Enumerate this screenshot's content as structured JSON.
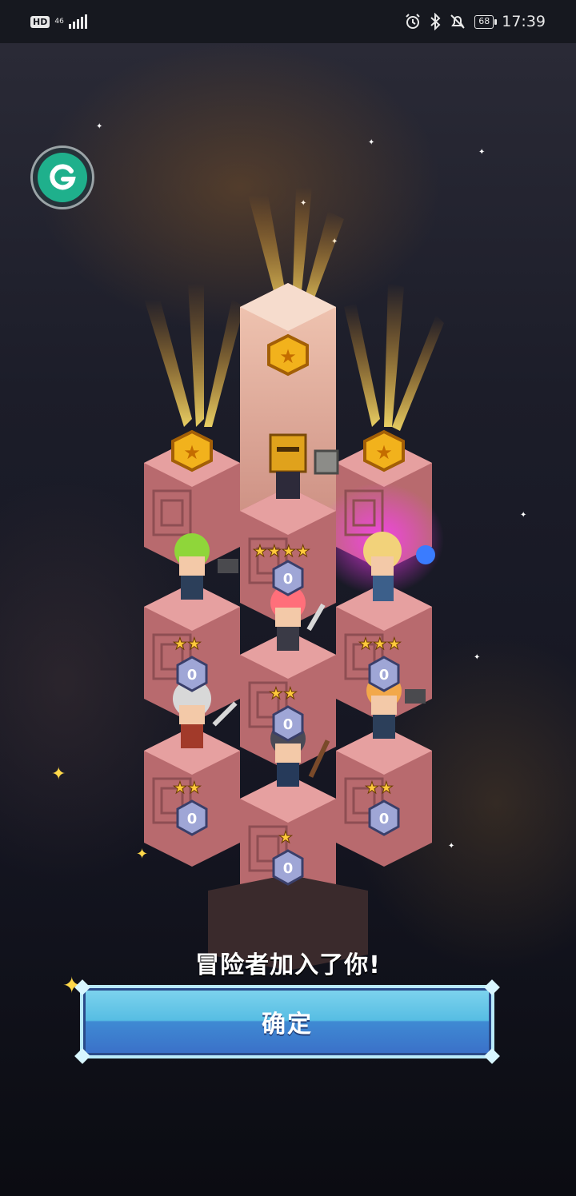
{
  "status_bar": {
    "hd": "HD",
    "network": "46",
    "battery": "68",
    "time": "17:39"
  },
  "app": {
    "g_button_icon": "g-logo-icon",
    "message": "冒险者加入了你!",
    "confirm_label": "确定"
  },
  "heroes": [
    {
      "name": "knight",
      "stars": 4,
      "level": "0"
    },
    {
      "name": "green-hair-hammer",
      "stars": 2,
      "level": "0"
    },
    {
      "name": "red-hair-sword",
      "stars": 2,
      "level": "0"
    },
    {
      "name": "blonde-mage",
      "stars": 3,
      "level": "0"
    },
    {
      "name": "white-hair-sword",
      "stars": 2,
      "level": "0"
    },
    {
      "name": "orange-hair-hammer",
      "stars": 2,
      "level": "0"
    },
    {
      "name": "dark-hair-staff",
      "stars": 1,
      "level": "0"
    }
  ],
  "colors": {
    "accent": "#56bde3",
    "block": "#c77a7d",
    "medal": "#f2b21c"
  }
}
